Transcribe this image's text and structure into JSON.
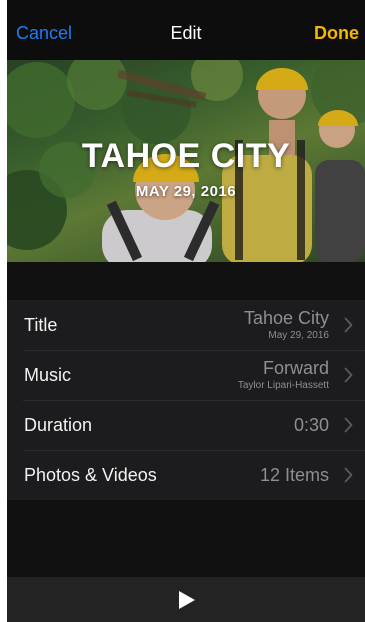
{
  "nav": {
    "cancel_label": "Cancel",
    "title": "Edit",
    "done_label": "Done"
  },
  "hero": {
    "title": "TAHOE CITY",
    "date": "MAY 29, 2016"
  },
  "rows": [
    {
      "label": "Title",
      "value": "Tahoe City",
      "sub": "May 29, 2016"
    },
    {
      "label": "Music",
      "value": "Forward",
      "sub": "Taylor Lipari-Hassett"
    },
    {
      "label": "Duration",
      "value": "0:30"
    },
    {
      "label": "Photos & Videos",
      "value": "12 Items"
    }
  ],
  "toolbar": {
    "play_icon": "play-icon"
  },
  "colors": {
    "cancel": "#1e7bf2",
    "done": "#f6b500",
    "background": "#111111",
    "list": "#1c1c1e"
  }
}
